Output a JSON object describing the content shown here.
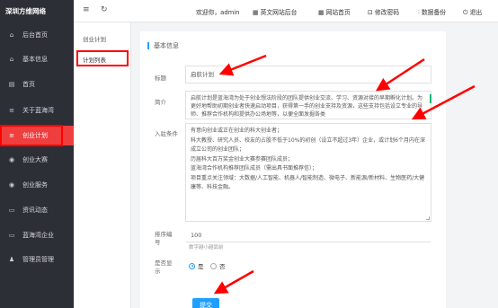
{
  "app": {
    "brand": "深圳方维网络"
  },
  "sidebar": {
    "items": [
      {
        "label": "后台首页",
        "icon": "home-icon"
      },
      {
        "label": "基本信息",
        "icon": "home-icon"
      },
      {
        "label": "首页",
        "icon": "document-icon"
      },
      {
        "label": "关于蓝海湾",
        "icon": "list-icon"
      },
      {
        "label": "创业计划",
        "icon": "list-icon",
        "active": true
      },
      {
        "label": "创业大赛",
        "icon": "globe-icon"
      },
      {
        "label": "创业服务",
        "icon": "globe-icon"
      },
      {
        "label": "资讯动态",
        "icon": "card-icon"
      },
      {
        "label": "蓝海湾企业",
        "icon": "card-icon"
      },
      {
        "label": "管理员管理",
        "icon": "users-icon"
      }
    ]
  },
  "topbar": {
    "welcome": "欢迎你，admin",
    "english_site": "英文网站后台",
    "site_home": "网站首页",
    "change_password": "修改密码",
    "backup": "数据备份",
    "logout": "退出"
  },
  "subnav": {
    "items": [
      {
        "label": "创业计划"
      },
      {
        "label": "计划列表",
        "current": true
      }
    ]
  },
  "form": {
    "section_title": "基本信息",
    "title_label": "标题",
    "title_value": "启航计划",
    "intro_label": "简介",
    "intro_value": "启航计划是蓝海湾为处于创业想法阶段的团队提供创业交流、学习、资源对接的早期孵化计划。为更好地帮助初期创业者快速启动项目，获得第一手的创业支持及资源，这些支持包括设立专业的导师、推荐合作机构和提供办公场地等，以便全面发掘各类",
    "conditions_label": "入驻条件",
    "conditions_value": "有意向创业或正在创业的科大创业者；\n科大教授、研究人员、校友的占股不低于10%的初创（设立不超过3年）企业，或计划6个月内在深成立公司的创业团队；\n历届科大百万奖金创业大赛参赛团队成员；\n蓝海湾合作机构推荐团队成员（需出具书面推荐信）；\n项目重点关注领域：大数据/人工智能、机器人/智能制造、微电子、新能源/新材料、生物医药/大健康等、科技金融。",
    "sort_label": "排序编号",
    "sort_value": "100",
    "sort_hint": "数字越小越靠前",
    "show_label": "是否显示",
    "show_yes": "是",
    "show_no": "否",
    "submit_label": "提交"
  },
  "colors": {
    "sidebar_bg": "#2c2f36",
    "active": "#ef3e3e",
    "primary": "#1e9fff",
    "annotation": "#ff0000"
  }
}
